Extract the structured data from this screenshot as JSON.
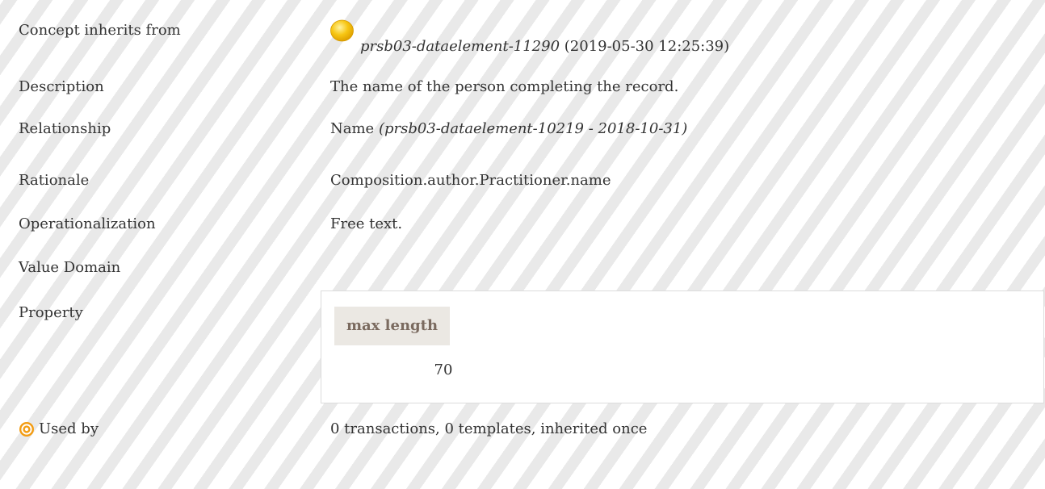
{
  "rows": {
    "inherits": {
      "label": "Concept inherits from",
      "link": "prsb03-dataelement-11290",
      "date": " (2019-05-30 12:25:39)"
    },
    "description": {
      "label": "Description",
      "value": "The name of the person completing the record."
    },
    "relationship": {
      "label": "Relationship",
      "value": "Name ",
      "ref": "(prsb03-dataelement-10219 - 2018-10-31)"
    },
    "rationale": {
      "label": "Rationale",
      "value": "Composition.author.Practitioner.name"
    },
    "operationalization": {
      "label": "Operationalization",
      "value": "Free text."
    },
    "value_domain": {
      "label": "Value Domain"
    },
    "property": {
      "label": "Property",
      "header": "max length",
      "value": "70"
    },
    "used_by": {
      "label": "Used by",
      "value": "0 transactions, 0 templates, inherited once"
    }
  },
  "colors": {
    "status_dot": "#f7c613",
    "used_icon": "#f39c12",
    "property_header_bg": "#ebe8e3",
    "property_header_text": "#7a6a5f"
  },
  "icons": {
    "status": "yellow-status-dot-icon",
    "used_by": "target-icon"
  }
}
